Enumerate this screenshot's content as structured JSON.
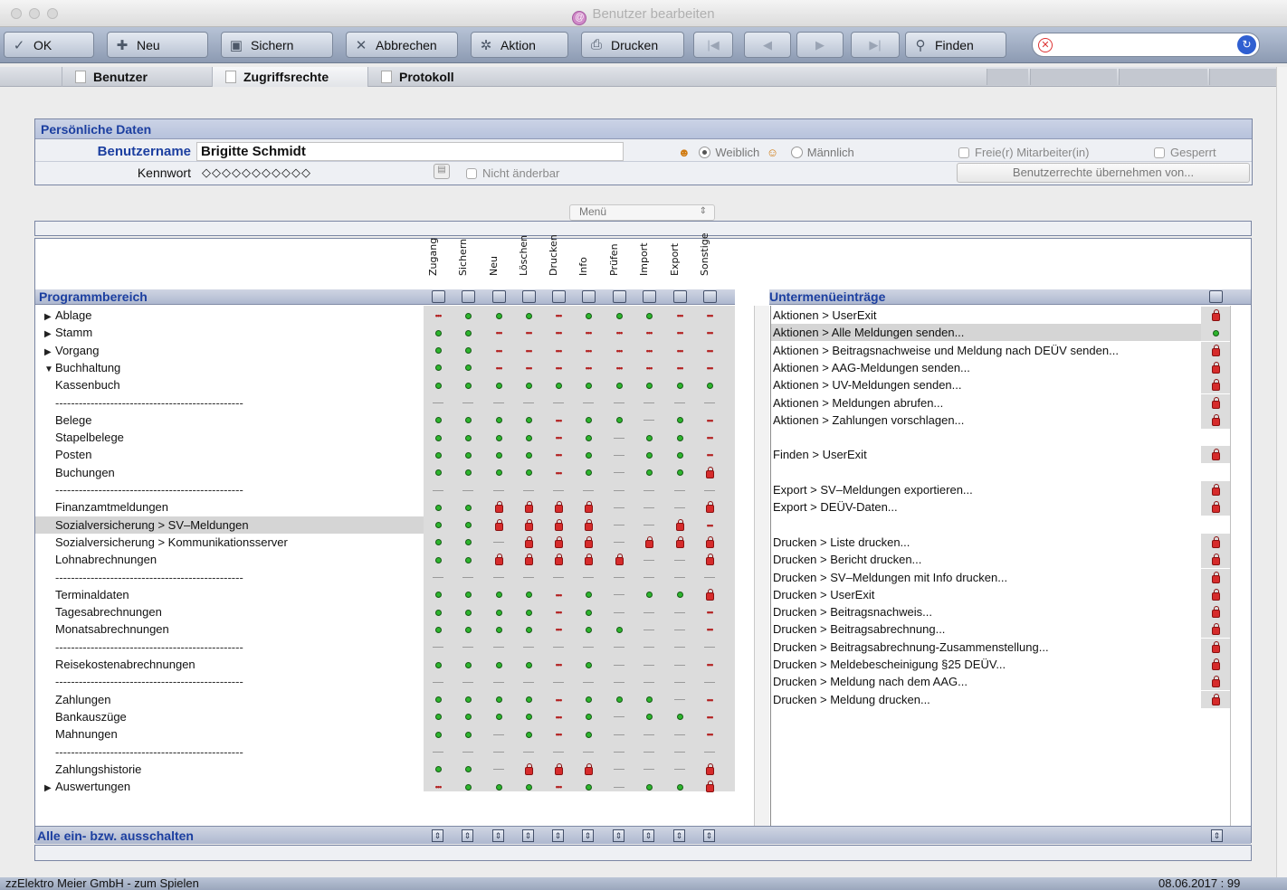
{
  "window": {
    "title": "Benutzer bearbeiten"
  },
  "toolbar": {
    "ok": "OK",
    "neu": "Neu",
    "sichern": "Sichern",
    "abbrechen": "Abbrechen",
    "aktion": "Aktion",
    "drucken": "Drucken",
    "finden": "Finden",
    "search_value": ""
  },
  "tabs": [
    "Benutzer",
    "Zugriffsrechte",
    "Protokoll"
  ],
  "personal": {
    "section_title": "Persönliche Daten",
    "username_label": "Benutzername",
    "username_value": "Brigitte Schmidt",
    "password_label": "Kennwort",
    "password_value": "◇◇◇◇◇◇◇◇◇◇◇",
    "not_changeable": "Nicht änderbar",
    "gender_female": "Weiblich",
    "gender_male": "Männlich",
    "freelancer": "Freie(r) Mitarbeiter(in)",
    "locked": "Gesperrt",
    "copy_rights_button": "Benutzerrechte übernehmen von..."
  },
  "menu_select": "Menü",
  "columns": [
    "Zugang",
    "Sichern",
    "Neu",
    "Löschen",
    "Drucken",
    "Info",
    "Prüfen",
    "Import",
    "Export",
    "Sonstige"
  ],
  "left_header": "Programmbereich",
  "right_header": "Untermenüeinträge",
  "rows": [
    {
      "label": "Ablage",
      "tri": "▶",
      "indent": 0,
      "cells": "mgggmgggmm"
    },
    {
      "label": "Stamm",
      "tri": "▶",
      "indent": 0,
      "cells": "ggmmmmmmmm"
    },
    {
      "label": "Vorgang",
      "tri": "▶",
      "indent": 0,
      "cells": "ggmmmmmmmm"
    },
    {
      "label": "Buchhaltung",
      "tri": "▼",
      "indent": 0,
      "cells": "ggmmmmmmmm"
    },
    {
      "label": "Kassenbuch",
      "tri": "",
      "indent": 1,
      "cells": "gggggggggg"
    },
    {
      "label": "------------------------------------------------",
      "tri": "",
      "indent": 1,
      "cells": "----------"
    },
    {
      "label": "Belege",
      "tri": "",
      "indent": 1,
      "cells": "ggggmgg-gm"
    },
    {
      "label": "Stapelbelege",
      "tri": "",
      "indent": 1,
      "cells": "ggggmg-ggm"
    },
    {
      "label": "Posten",
      "tri": "",
      "indent": 1,
      "cells": "ggggmg-ggm"
    },
    {
      "label": "Buchungen",
      "tri": "",
      "indent": 1,
      "cells": "ggggmg-ggl"
    },
    {
      "label": "------------------------------------------------",
      "tri": "",
      "indent": 1,
      "cells": "----------"
    },
    {
      "label": "Finanzamtmeldungen",
      "tri": "",
      "indent": 1,
      "cells": "ggllll---l"
    },
    {
      "label": "Sozialversicherung > SV–Meldungen",
      "tri": "",
      "indent": 1,
      "cells": "ggllll--lm",
      "hl": true
    },
    {
      "label": "Sozialversicherung > Kommunikationsserver",
      "tri": "",
      "indent": 1,
      "cells": "gg-lll-lll"
    },
    {
      "label": "Lohnabrechnungen",
      "tri": "",
      "indent": 1,
      "cells": "gglllll--l"
    },
    {
      "label": "------------------------------------------------",
      "tri": "",
      "indent": 1,
      "cells": "----------"
    },
    {
      "label": "Terminaldaten",
      "tri": "",
      "indent": 1,
      "cells": "ggggmg-ggl"
    },
    {
      "label": "Tagesabrechnungen",
      "tri": "",
      "indent": 1,
      "cells": "ggggmg---m"
    },
    {
      "label": "Monatsabrechnungen",
      "tri": "",
      "indent": 1,
      "cells": "ggggmgg--m"
    },
    {
      "label": "------------------------------------------------",
      "tri": "",
      "indent": 1,
      "cells": "----------"
    },
    {
      "label": "Reisekostenabrechnungen",
      "tri": "",
      "indent": 1,
      "cells": "ggggmg---m"
    },
    {
      "label": "------------------------------------------------",
      "tri": "",
      "indent": 1,
      "cells": "----------"
    },
    {
      "label": "Zahlungen",
      "tri": "",
      "indent": 1,
      "cells": "ggggmggg-m"
    },
    {
      "label": "Bankauszüge",
      "tri": "",
      "indent": 1,
      "cells": "ggggmg-ggm"
    },
    {
      "label": "Mahnungen",
      "tri": "",
      "indent": 1,
      "cells": "gg-gmg---m"
    },
    {
      "label": "------------------------------------------------",
      "tri": "",
      "indent": 1,
      "cells": "----------"
    },
    {
      "label": "Zahlungshistorie",
      "tri": "",
      "indent": 1,
      "cells": "gg-lll---l"
    },
    {
      "label": "Auswertungen",
      "tri": "▶",
      "indent": 0,
      "cells": "mgggmg-ggl"
    }
  ],
  "subitems": [
    {
      "label": "Aktionen > UserExit",
      "status": "l"
    },
    {
      "label": "Aktionen > Alle Meldungen senden...",
      "status": "g",
      "hl": true
    },
    {
      "label": "Aktionen > Beitragsnachweise und Meldung nach DEÜV senden...",
      "status": "l"
    },
    {
      "label": "Aktionen > AAG-Meldungen senden...",
      "status": "l"
    },
    {
      "label": "Aktionen > UV-Meldungen senden...",
      "status": "l"
    },
    {
      "label": "Aktionen > Meldungen abrufen...",
      "status": "l"
    },
    {
      "label": "Aktionen > Zahlungen vorschlagen...",
      "status": "l"
    },
    {
      "label": "",
      "status": ""
    },
    {
      "label": "Finden > UserExit",
      "status": "l"
    },
    {
      "label": "",
      "status": ""
    },
    {
      "label": "Export > SV–Meldungen exportieren...",
      "status": "l"
    },
    {
      "label": "Export > DEÜV-Daten...",
      "status": "l"
    },
    {
      "label": "",
      "status": ""
    },
    {
      "label": "Drucken > Liste drucken...",
      "status": "l"
    },
    {
      "label": "Drucken > Bericht drucken...",
      "status": "l"
    },
    {
      "label": "Drucken > SV–Meldungen mit Info drucken...",
      "status": "l"
    },
    {
      "label": "Drucken > UserExit",
      "status": "l"
    },
    {
      "label": "Drucken > Beitragsnachweis...",
      "status": "l"
    },
    {
      "label": "Drucken > Beitragsabrechnung...",
      "status": "l"
    },
    {
      "label": "Drucken > Beitragsabrechnung-Zusammenstellung...",
      "status": "l"
    },
    {
      "label": "Drucken > Meldebescheinigung §25 DEÜV...",
      "status": "l"
    },
    {
      "label": "Drucken > Meldung nach dem AAG...",
      "status": "l"
    },
    {
      "label": "Drucken > Meldung drucken...",
      "status": "l"
    }
  ],
  "footer": {
    "toggle_all": "Alle ein- bzw. ausschalten"
  },
  "status": {
    "company": "zzElektro Meier GmbH - zum Spielen",
    "date": "08.06.2017 : 99"
  }
}
